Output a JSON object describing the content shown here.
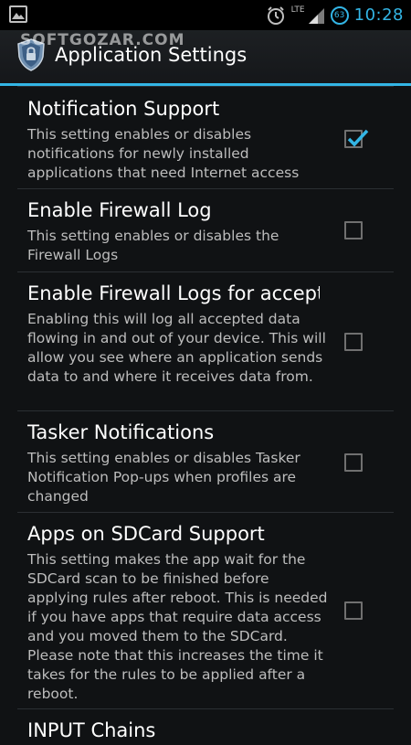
{
  "status_bar": {
    "time": "10:28",
    "battery": "63",
    "network": "LTE",
    "icons": [
      "gallery-icon",
      "alarm-icon",
      "signal-icon",
      "battery-icon"
    ]
  },
  "watermark": "SOFTGOZAR.COM",
  "action_bar": {
    "title": "Application Settings",
    "icon": "shield-icon",
    "accent_color": "#33b5e5"
  },
  "settings": [
    {
      "title": "Notification Support",
      "description": "This setting enables or disables notifications for newly installed applications that need Internet access",
      "checked": true
    },
    {
      "title": "Enable Firewall Log",
      "description": "This setting enables or disables the Firewall Logs",
      "checked": false
    },
    {
      "title": "Enable Firewall Logs for accept",
      "description": "Enabling this will log all accepted data flowing in and out of your device. This will allow you see where an application sends data to and where it receives data from.",
      "checked": false
    },
    {
      "title": "Tasker Notifications",
      "description": "This setting enables or disables Tasker Notification Pop-ups when profiles are changed",
      "checked": false
    },
    {
      "title": "Apps on SDCard Support",
      "description": "This setting makes the app wait for the SDCard scan to be finished before applying rules after reboot. This is needed if you have apps that require data access and you moved them to the SDCard. Please note that this increases the time it takes for the rules to be applied after a reboot.",
      "checked": false
    },
    {
      "title": "INPUT Chains",
      "description": "",
      "checked": false
    }
  ]
}
